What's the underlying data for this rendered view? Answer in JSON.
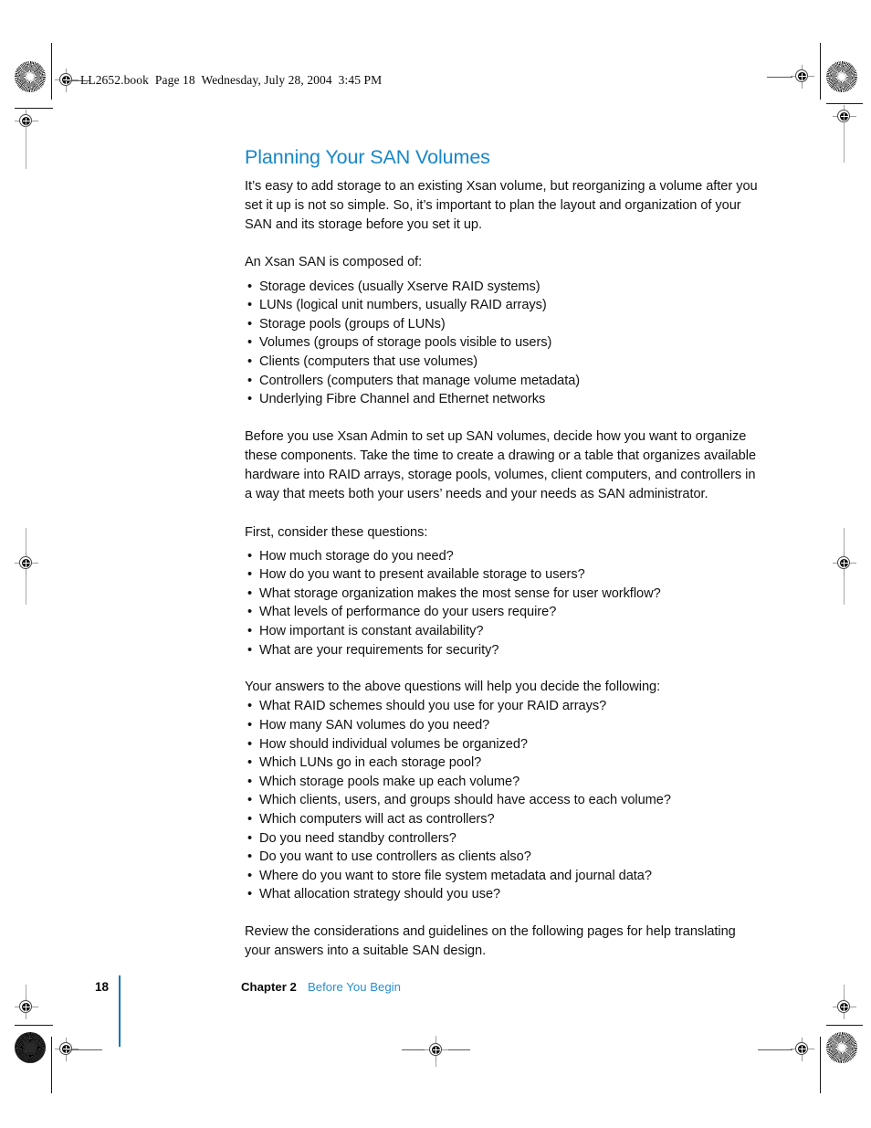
{
  "running_head": "LL2652.book  Page 18  Wednesday, July 28, 2004  3:45 PM",
  "colors": {
    "heading_blue": "#1787c9",
    "link_blue": "#2a8fd0",
    "rule_blue": "#0e74b8",
    "body_text": "#111111"
  },
  "content": {
    "title": "Planning Your SAN Volumes",
    "intro_paragraph": "It’s easy to add storage to an existing Xsan volume, but reorganizing a volume after you set it up is not so simple. So, it’s important to plan the layout and organization of your SAN and its storage before you set it up.",
    "composed_lead_in": "An Xsan SAN is composed of:",
    "composed_items": [
      "Storage devices (usually Xserve RAID systems)",
      "LUNs (logical unit numbers, usually RAID arrays)",
      "Storage pools (groups of LUNs)",
      "Volumes (groups of storage pools visible to users)",
      "Clients (computers that use volumes)",
      "Controllers (computers that manage volume metadata)",
      "Underlying Fibre Channel and Ethernet networks"
    ],
    "organize_paragraph": "Before you use Xsan Admin to set up SAN volumes, decide how you want to organize these components. Take the time to create a drawing or a table that organizes available hardware into RAID arrays, storage pools, volumes, client computers, and controllers in a way that meets both your users’ needs and your needs as SAN administrator.",
    "questions_lead_in": "First, consider these questions:",
    "questions_items": [
      "How much storage do you need?",
      "How do you want to present available storage to users?",
      "What storage organization makes the most sense for user workflow?",
      "What levels of performance do your users require?",
      "How important is constant availability?",
      "What are your requirements for security?"
    ],
    "decide_lead_in": "Your answers to the above questions will help you decide the following:",
    "decide_items": [
      "What RAID schemes should you use for your RAID arrays?",
      "How many SAN volumes do you need?",
      "How should individual volumes be organized?",
      "Which LUNs go in each storage pool?",
      "Which storage pools make up each volume?",
      "Which clients, users, and groups should have access to each volume?",
      "Which computers will act as controllers?",
      "Do you need standby controllers?",
      "Do you want to use controllers as clients also?",
      "Where do you want to store file system metadata and journal data?",
      "What allocation strategy should you use?"
    ],
    "closing_paragraph": "Review the considerations and guidelines on the following pages for help translating your answers into a suitable SAN design.",
    "bullet_glyph": "•"
  },
  "footer": {
    "page_number": "18",
    "chapter_label": "Chapter 2",
    "chapter_title": "Before You Begin"
  }
}
